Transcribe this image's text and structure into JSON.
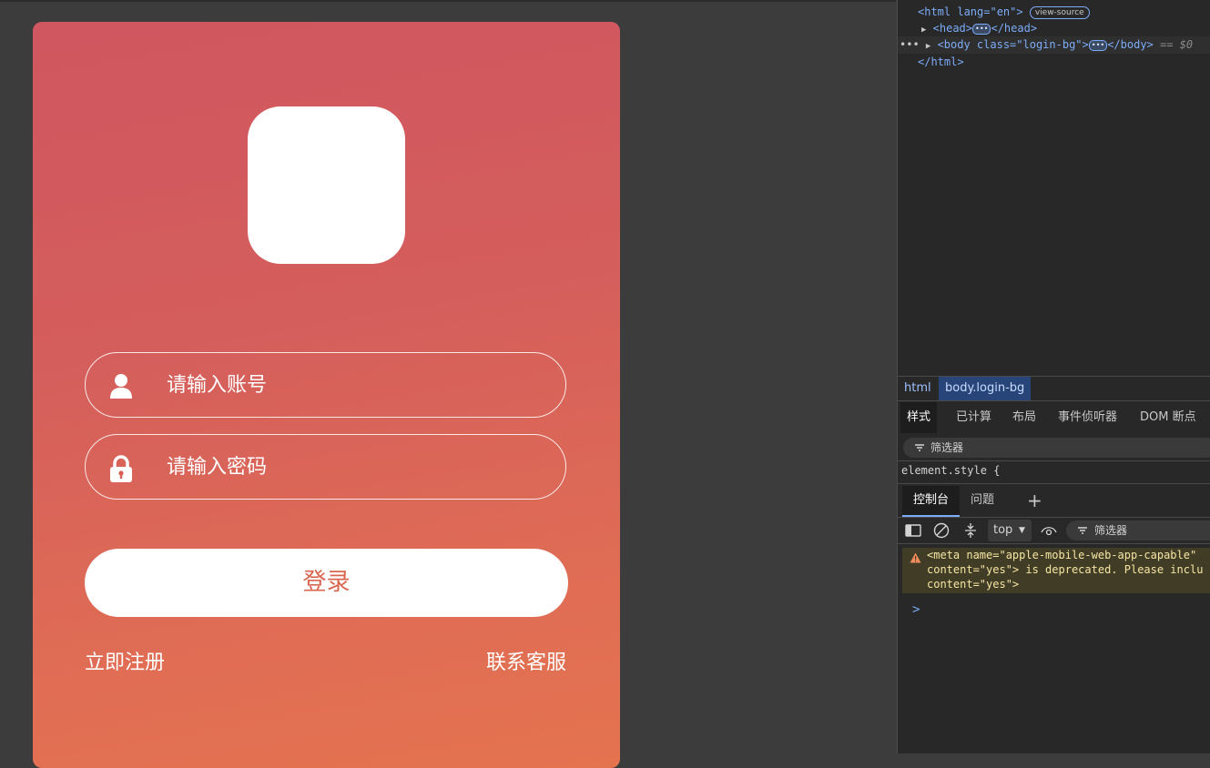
{
  "login": {
    "account_placeholder": "请输入账号",
    "password_placeholder": "请输入密码",
    "login_button": "登录",
    "register_link": "立即注册",
    "support_link": "联系客服"
  },
  "devtools": {
    "dom": {
      "html_open": "<html lang=\"en\">",
      "view_source": "view-source",
      "head": "<head>",
      "head_close": "</head>",
      "body_open": "<body class=\"login-bg\">",
      "body_close": "</body>",
      "body_ref": "== $0",
      "html_close": "</html>"
    },
    "breadcrumb": [
      "html",
      "body.login-bg"
    ],
    "tabs": [
      "样式",
      "已计算",
      "布局",
      "事件侦听器",
      "DOM 断点"
    ],
    "styles_filter": "筛选器",
    "element_style": "element.style {",
    "drawer_tabs": [
      "控制台",
      "问题"
    ],
    "context_select": "top",
    "console_filter": "筛选器",
    "warning_lines": [
      "<meta name=\"apple-mobile-web-app-capable\" ",
      "content=\"yes\"> is deprecated. Please inclu",
      "content=\"yes\">"
    ],
    "prompt": ">"
  },
  "colors": {
    "gradient_top": "#d0565f",
    "gradient_bottom": "#e4734f",
    "login_text": "#d9664f",
    "devtools_bg": "#282828",
    "accent_blue": "#7cacf8"
  }
}
